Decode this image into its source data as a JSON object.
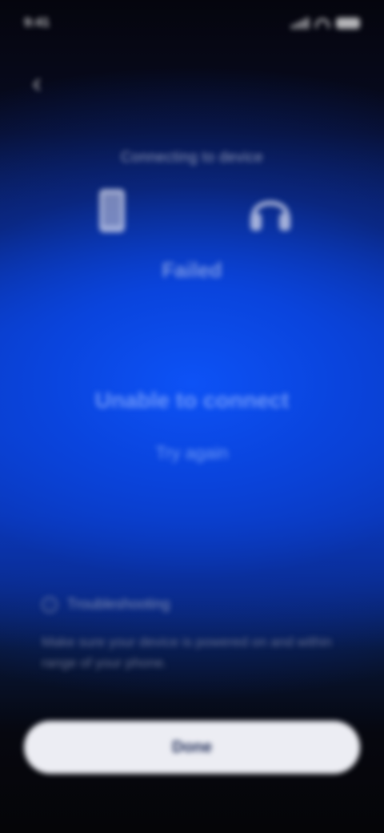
{
  "status_bar": {
    "time": "9:41"
  },
  "header": {
    "back_icon": "chevron-left-icon",
    "title": "Connecting to device"
  },
  "devices": {
    "left_icon": "phone-icon",
    "right_icon": "headphones-icon"
  },
  "connection": {
    "label": "Failed"
  },
  "message": {
    "title": "Unable to connect",
    "retry_label": "Try again"
  },
  "info": {
    "icon": "info-icon",
    "title": "Troubleshooting",
    "text": "Make sure your device is powered on and within range of your phone."
  },
  "footer": {
    "primary_label": "Done"
  },
  "colors": {
    "accent_blue": "#0b46e6",
    "background_dark": "#05050d",
    "button_bg": "#ecedf3"
  }
}
